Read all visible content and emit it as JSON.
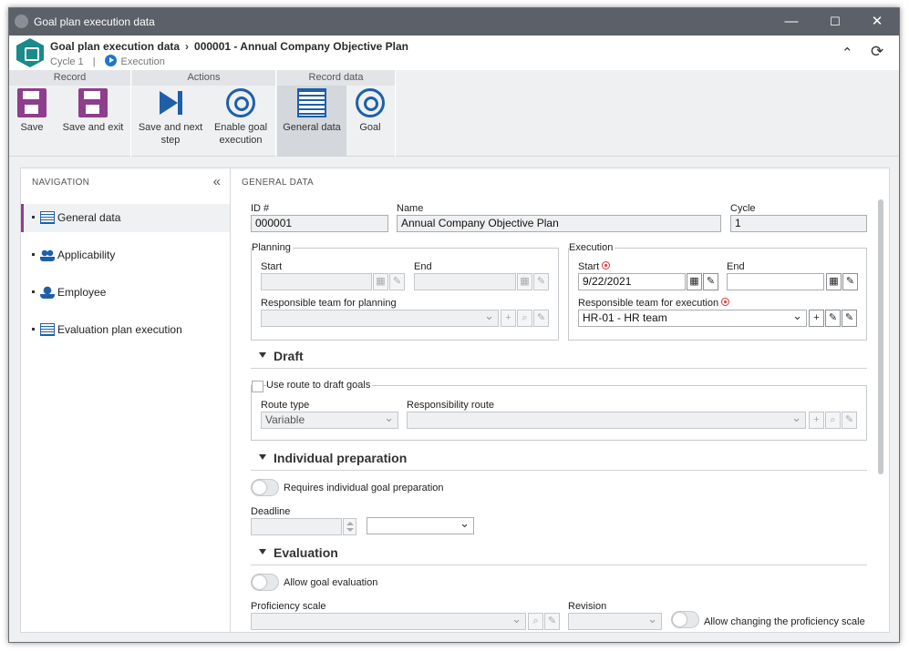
{
  "window": {
    "title": "Goal plan execution data",
    "minimize": "—",
    "maximize": "☐",
    "close": "✕"
  },
  "header": {
    "breadcrumb_root": "Goal plan execution data",
    "breadcrumb_separator": "›",
    "breadcrumb_record": "000001 - Annual Company Objective Plan",
    "cycle": "Cycle 1",
    "status": "Execution"
  },
  "ribbon": {
    "groups": {
      "record": "Record",
      "actions": "Actions",
      "record_data": "Record data"
    },
    "save": "Save",
    "save_exit": "Save and exit",
    "save_next_1": "Save and next",
    "save_next_2": "step",
    "enable_goal_1": "Enable goal",
    "enable_goal_2": "execution",
    "general_data": "General data",
    "goal": "Goal"
  },
  "navigation": {
    "title": "NAVIGATION",
    "items": [
      {
        "label": "General data",
        "icon": "list-icon"
      },
      {
        "label": "Applicability",
        "icon": "people-icon"
      },
      {
        "label": "Employee",
        "icon": "person-icon"
      },
      {
        "label": "Evaluation plan execution",
        "icon": "evaluation-icon"
      }
    ]
  },
  "form": {
    "title": "GENERAL DATA",
    "id_label": "ID #",
    "id_value": "000001",
    "name_label": "Name",
    "name_value": "Annual Company Objective Plan",
    "cycle_label": "Cycle",
    "cycle_value": "1",
    "planning": {
      "legend": "Planning",
      "start": "Start",
      "end": "End",
      "team_label": "Responsible team for planning"
    },
    "execution": {
      "legend": "Execution",
      "start": "Start",
      "start_value": "9/22/2021",
      "end": "End",
      "team_label": "Responsible team for execution",
      "team_value": "HR-01 - HR team"
    },
    "draft": {
      "title": "Draft",
      "use_route": "Use route to draft goals",
      "route_type": "Route type",
      "route_type_value": "Variable",
      "responsibility_route": "Responsibility route"
    },
    "individual": {
      "title": "Individual preparation",
      "requires": "Requires individual goal preparation",
      "deadline": "Deadline"
    },
    "evaluation": {
      "title": "Evaluation",
      "allow": "Allow goal evaluation",
      "scale": "Proficiency scale",
      "revision": "Revision",
      "allow_change": "Allow changing the proficiency scale"
    }
  }
}
